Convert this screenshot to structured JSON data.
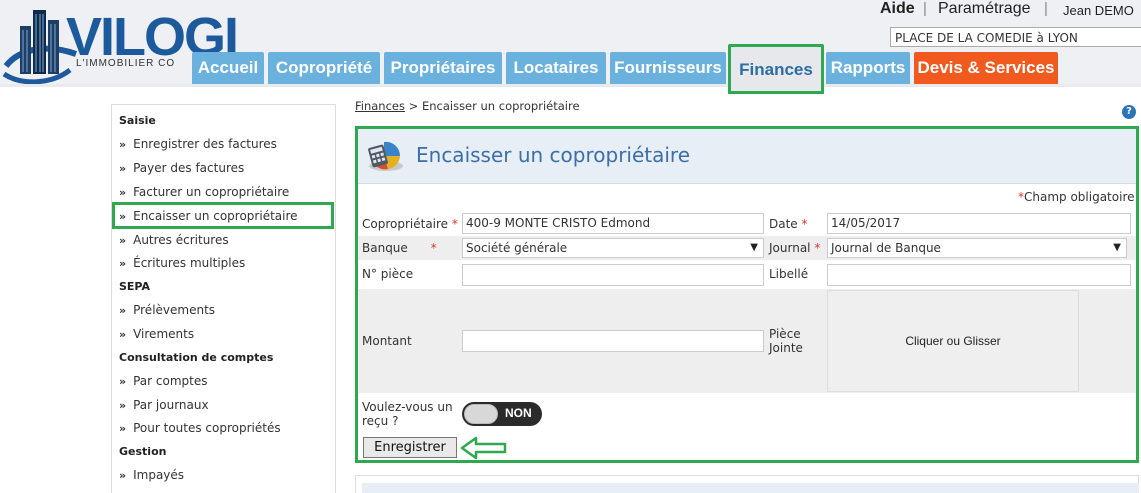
{
  "brand": {
    "name": "VILOGI",
    "tagline": "L'IMMOBILIER CO"
  },
  "toplinks": {
    "help": "Aide",
    "separator": "|",
    "settings": "Paramétrage",
    "user": "Jean DEMO"
  },
  "location": {
    "value": "PLACE DE LA COMEDIE à LYON"
  },
  "nav": {
    "tabs": [
      "Accueil",
      "Copropriété",
      "Propriétaires",
      "Locataires",
      "Fournisseurs",
      "Finances",
      "Rapports",
      "Devis & Services"
    ],
    "active": "Finances"
  },
  "breadcrumb": {
    "link": "Finances",
    "sep": " > ",
    "current": "Encaisser un copropriétaire"
  },
  "sidebar": {
    "sections": [
      {
        "title": "Saisie",
        "items": [
          "Enregistrer des factures",
          "Payer des factures",
          "Facturer un copropriétaire",
          "Encaisser un copropriétaire",
          "Autres écritures",
          "Écritures multiples"
        ]
      },
      {
        "title": "SEPA",
        "items": [
          "Prélèvements",
          "Virements"
        ]
      },
      {
        "title": "Consultation de comptes",
        "items": [
          "Par comptes",
          "Par journaux",
          "Pour toutes copropriétés"
        ]
      },
      {
        "title": "Gestion",
        "items": [
          "Impayés"
        ]
      }
    ],
    "bullet": "»"
  },
  "form": {
    "title": "Encaisser un copropriétaire",
    "required_note": "Champ obligatoire",
    "required_mark": "*",
    "fields": {
      "coproprietaire": {
        "label": "Copropriétaire",
        "value": "400-9 MONTE CRISTO Edmond"
      },
      "date": {
        "label": "Date",
        "value": "14/05/2017"
      },
      "banque": {
        "label": "Banque",
        "value": "Société générale"
      },
      "journal": {
        "label": "Journal",
        "value": "Journal de Banque"
      },
      "piece": {
        "label": "N° pièce",
        "value": ""
      },
      "libelle": {
        "label": "Libellé",
        "value": ""
      },
      "montant": {
        "label": "Montant",
        "value": ""
      },
      "piece_jointe": {
        "label_line1": "Pièce",
        "label_line2": "Jointe",
        "dropzone": "Cliquer ou Glisser"
      },
      "recu": {
        "label_line1": "Voulez-vous un",
        "label_line2": "reçu ?",
        "toggle": "NON"
      }
    },
    "submit": "Enregistrer"
  },
  "colors": {
    "tab": "#6ab1de",
    "tab_orange": "#f05a1e",
    "highlight": "#2fa84f",
    "title": "#3b6fa8"
  },
  "icons": {
    "caret": "▼",
    "help": "?"
  }
}
